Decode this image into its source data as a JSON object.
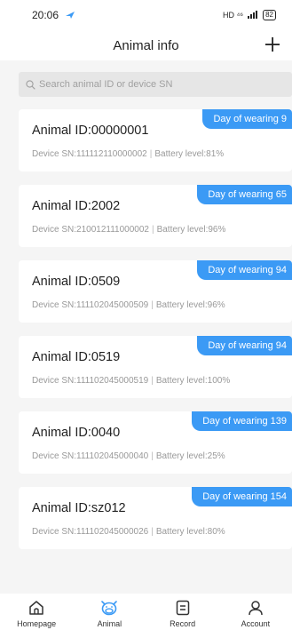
{
  "status_bar": {
    "time": "20:06",
    "network": "HD ⁴⁶",
    "battery": "82"
  },
  "header": {
    "title": "Animal info",
    "add_label": "+"
  },
  "search": {
    "placeholder": "Search animal ID or device SN"
  },
  "cards": [
    {
      "badge": "Day of wearing 9",
      "animal_id": "Animal ID:00000001",
      "device_sn": "Device SN:111112110000002",
      "battery": "Battery level:81%"
    },
    {
      "badge": "Day of wearing 65",
      "animal_id": "Animal ID:2002",
      "device_sn": "Device SN:210012111000002",
      "battery": "Battery level:96%"
    },
    {
      "badge": "Day of wearing 94",
      "animal_id": "Animal ID:0509",
      "device_sn": "Device SN:111102045000509",
      "battery": "Battery level:96%"
    },
    {
      "badge": "Day of wearing 94",
      "animal_id": "Animal ID:0519",
      "device_sn": "Device SN:111102045000519",
      "battery": "Battery level:100%"
    },
    {
      "badge": "Day of wearing 139",
      "animal_id": "Animal ID:0040",
      "device_sn": "Device SN:111102045000040",
      "battery": "Battery level:25%"
    },
    {
      "badge": "Day of wearing 154",
      "animal_id": "Animal ID:sz012",
      "device_sn": "Device SN:111102045000026",
      "battery": "Battery level:80%"
    }
  ],
  "nav": {
    "items": [
      {
        "label": "Homepage",
        "icon": "home-icon"
      },
      {
        "label": "Animal",
        "icon": "animal-icon",
        "active": true
      },
      {
        "label": "Record",
        "icon": "record-icon"
      },
      {
        "label": "Account",
        "icon": "account-icon"
      }
    ]
  },
  "colors": {
    "accent": "#3b9af5",
    "background": "#f5f5f5"
  }
}
